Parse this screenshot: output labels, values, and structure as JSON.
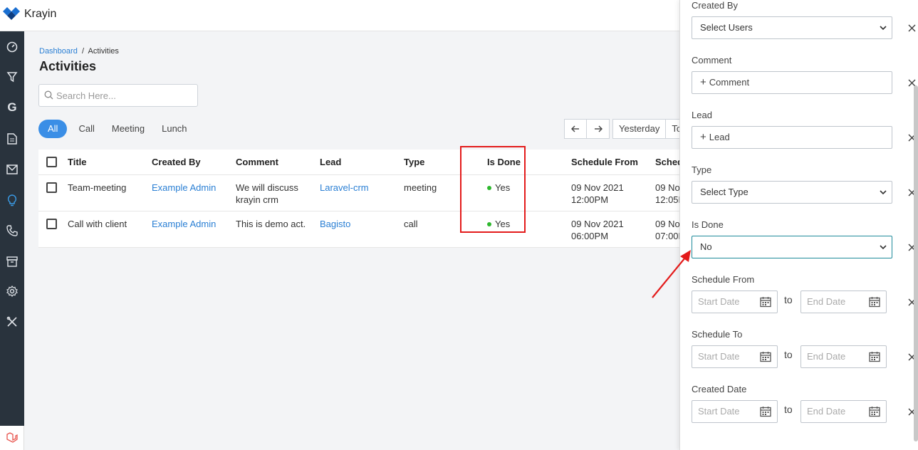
{
  "app": {
    "name": "Krayin"
  },
  "breadcrumb": {
    "root": "Dashboard",
    "separator": "/",
    "current": "Activities"
  },
  "page": {
    "title": "Activities"
  },
  "search": {
    "placeholder": "Search Here..."
  },
  "tabs": [
    {
      "label": "All",
      "active": true
    },
    {
      "label": "Call",
      "active": false
    },
    {
      "label": "Meeting",
      "active": false
    },
    {
      "label": "Lunch",
      "active": false
    }
  ],
  "date_nav": {
    "yesterday": "Yesterday",
    "today": "To"
  },
  "table": {
    "columns": [
      "Title",
      "Created By",
      "Comment",
      "Lead",
      "Type",
      "Is Done",
      "Schedule From",
      "Sched"
    ],
    "rows": [
      {
        "title": "Team-meeting",
        "created_by": "Example Admin",
        "comment_1": "We will discuss",
        "comment_2": "krayin crm",
        "lead": "Laravel-crm",
        "type": "meeting",
        "is_done": "Yes",
        "schedule_from_date": "09 Nov 2021",
        "schedule_from_time": "12:00PM",
        "schedule_to_date": "09 Nov",
        "schedule_to_time": "12:05P"
      },
      {
        "title": "Call with client",
        "created_by": "Example Admin",
        "comment_1": "This is demo act.",
        "comment_2": "",
        "lead": "Bagisto",
        "type": "call",
        "is_done": "Yes",
        "schedule_from_date": "09 Nov 2021",
        "schedule_from_time": "06:00PM",
        "schedule_to_date": "09 Nov",
        "schedule_to_time": "07:00P"
      }
    ]
  },
  "filters": {
    "created_by": {
      "label": "Created By",
      "value": "Select Users"
    },
    "comment": {
      "label": "Comment",
      "value": "Comment"
    },
    "lead": {
      "label": "Lead",
      "value": "Lead"
    },
    "type": {
      "label": "Type",
      "value": "Select Type"
    },
    "is_done": {
      "label": "Is Done",
      "value": "No"
    },
    "schedule_from": {
      "label": "Schedule From",
      "start": "Start Date",
      "to": "to",
      "end": "End Date"
    },
    "schedule_to": {
      "label": "Schedule To",
      "start": "Start Date",
      "to": "to",
      "end": "End Date"
    },
    "created_date": {
      "label": "Created Date",
      "start": "Start Date",
      "to": "to",
      "end": "End Date"
    }
  },
  "colors": {
    "accent": "#3a8ee6",
    "link": "#2a7fd4",
    "sidebar": "#29333d",
    "highlight": "#e31b1b",
    "done_dot": "#2eb82e"
  },
  "sidebar_icons": [
    "dashboard-icon",
    "filter-icon",
    "google-icon",
    "document-icon",
    "mail-icon",
    "lightbulb-icon",
    "phone-icon",
    "archive-icon",
    "settings-icon",
    "tools-icon"
  ]
}
